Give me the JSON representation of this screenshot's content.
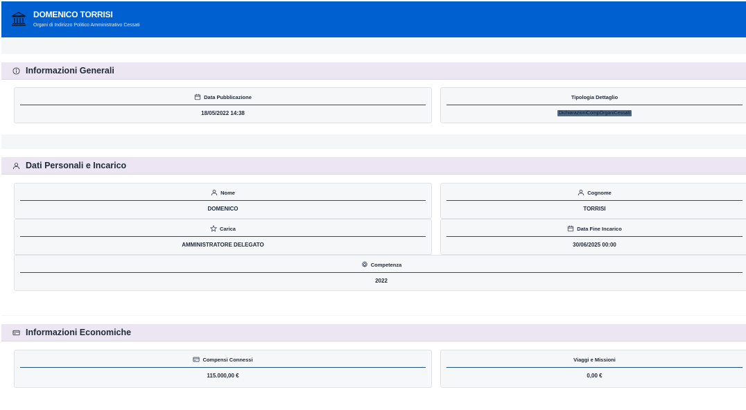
{
  "header": {
    "title": "DOMENICO TORRISI",
    "subtitle": "Organi di Indirizzo Politico Amministrativo Cessati",
    "icon": "institution-icon",
    "color": "#0060d0"
  },
  "sections": {
    "general": {
      "title": "Informazioni Generali",
      "icon": "info-icon",
      "cards": {
        "pub_date": {
          "label": "Data Pubblicazione",
          "icon": "calendar-icon",
          "value": "18/05/2022 14:38"
        },
        "type": {
          "label": "Tipologia Dettaglio",
          "value": "DichiarazioniCompOrganiCessati"
        }
      }
    },
    "personal": {
      "title": "Dati Personali e Incarico",
      "icon": "person-icon",
      "cards": {
        "name": {
          "label": "Nome",
          "icon": "person-icon",
          "value": "DOMENICO"
        },
        "surname": {
          "label": "Cognome",
          "icon": "person-icon",
          "value": "TORRISI"
        },
        "role": {
          "label": "Carica",
          "icon": "star-icon",
          "value": "AMMINISTRATORE DELEGATO"
        },
        "end_date": {
          "label": "Data Fine Incarico",
          "icon": "calendar-icon",
          "value": "30/06/2025 00:00"
        },
        "competence": {
          "label": "Competenza",
          "icon": "gear-icon",
          "value": "2022"
        }
      }
    },
    "economic": {
      "title": "Informazioni Economiche",
      "icon": "credit-card-icon",
      "cards": {
        "compensation": {
          "label": "Compensi Connessi",
          "icon": "credit-card-icon",
          "value": "115.000,00 €"
        },
        "travel": {
          "label": "Viaggi e Missioni",
          "value": "0,00 €"
        }
      }
    }
  }
}
